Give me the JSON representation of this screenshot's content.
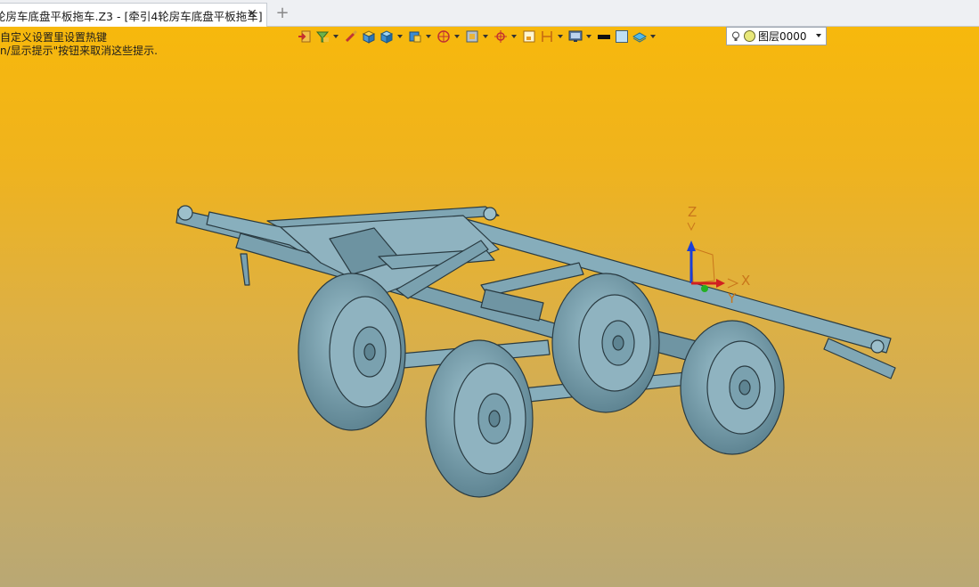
{
  "tab": {
    "title": "轮房车底盘平板拖车.Z3 - [牵引4轮房车底盘平板拖车]",
    "close_glyph": "✕",
    "new_tab_glyph": "+"
  },
  "viewport": {
    "hint_line1": "自定义设置里设置热键",
    "hint_line2": "n/显示提示\"按钮来取消这些提示."
  },
  "toolbar": {
    "buttons": [
      "exit-icon",
      "filter-icon",
      "brush-icon",
      "box-shaded-icon",
      "box-solid-icon",
      "view-cube-icon",
      "section-icon",
      "display-mode-icon",
      "origin-icon",
      "frame-icon",
      "dimension-icon",
      "monitor-icon",
      "line-color-icon",
      "fill-color-icon",
      "layer-stack-icon"
    ],
    "layer": {
      "name": "图层0000"
    }
  },
  "triad": {
    "x_label": "X",
    "y_label": "Y",
    "z_label": "Z"
  },
  "colors": {
    "model_fill": "#7fa6b4",
    "model_edge": "#2a3b42",
    "triad_x": "#d12020",
    "triad_y": "#23b023",
    "triad_z": "#1b3fd6",
    "bg_top": "#f7b80c",
    "bg_bottom": "#b9a874"
  }
}
